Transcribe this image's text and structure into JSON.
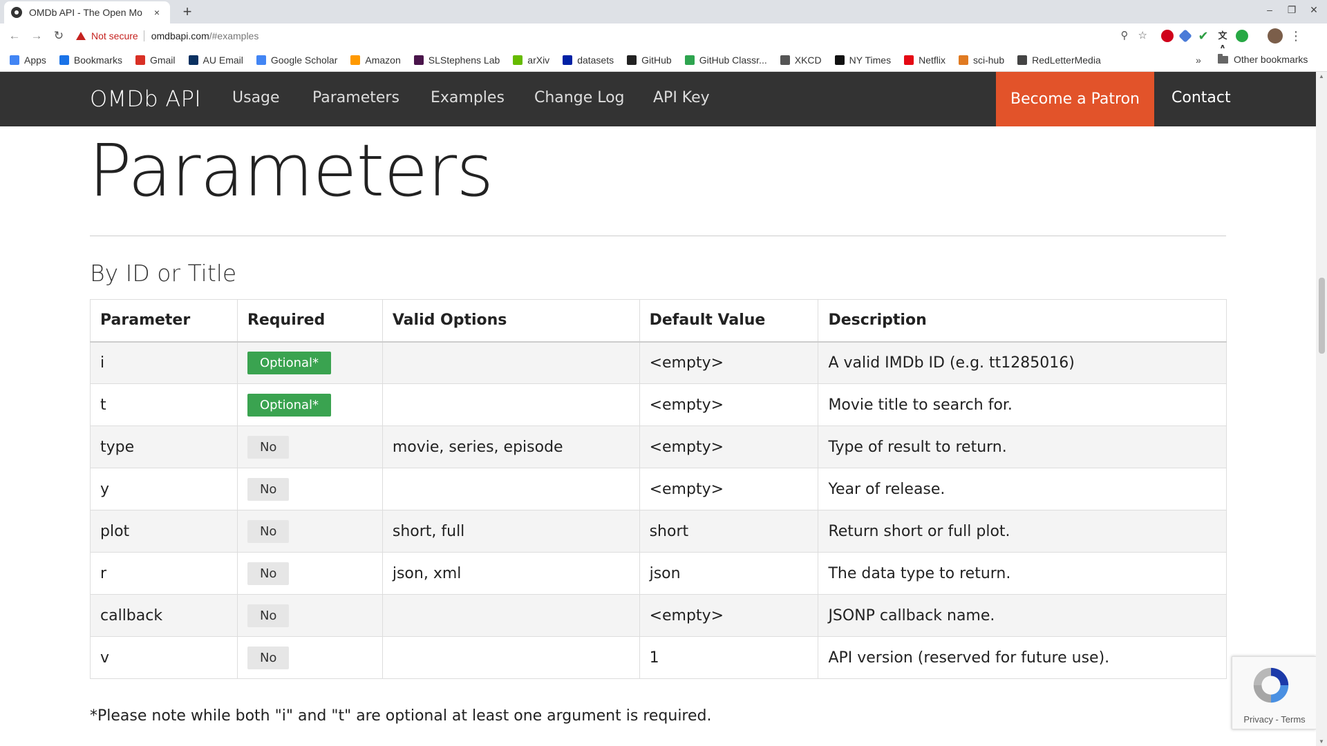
{
  "browser": {
    "tab_title": "OMDb API - The Open Mo",
    "tab_close": "×",
    "new_tab": "+",
    "not_secure": "Not secure",
    "url_host": "omdbapi.com",
    "url_path": "/#examples",
    "bookmarks": [
      {
        "label": "Apps",
        "icon": "apps-grid-icon",
        "color": "#4285f4"
      },
      {
        "label": "Bookmarks",
        "icon": "star-icon",
        "color": "#1a73e8"
      },
      {
        "label": "Gmail",
        "icon": "gmail-icon",
        "color": "#d93025"
      },
      {
        "label": "AU Email",
        "icon": "au-icon",
        "color": "#0a3161"
      },
      {
        "label": "Google Scholar",
        "icon": "scholar-icon",
        "color": "#4285f4"
      },
      {
        "label": "Amazon",
        "icon": "amazon-icon",
        "color": "#ff9900"
      },
      {
        "label": "SLStephens Lab",
        "icon": "slack-icon",
        "color": "#4a154b"
      },
      {
        "label": "arXiv",
        "icon": "arxiv-icon",
        "color": "#66bb00"
      },
      {
        "label": "datasets",
        "icon": "uf-icon",
        "color": "#0021a5"
      },
      {
        "label": "GitHub",
        "icon": "github-icon",
        "color": "#222222"
      },
      {
        "label": "GitHub Classr...",
        "icon": "github-classroom-icon",
        "color": "#2ea44f"
      },
      {
        "label": "XKCD",
        "icon": "xkcd-icon",
        "color": "#555555"
      },
      {
        "label": "NY Times",
        "icon": "nytimes-icon",
        "color": "#111111"
      },
      {
        "label": "Netflix",
        "icon": "netflix-icon",
        "color": "#e50914"
      },
      {
        "label": "sci-hub",
        "icon": "scihub-icon",
        "color": "#e07a22"
      },
      {
        "label": "RedLetterMedia",
        "icon": "rlm-icon",
        "color": "#444444"
      }
    ],
    "bookmarks_more": "»",
    "other_bookmarks": "Other bookmarks"
  },
  "site_nav": {
    "brand": "OMDb API",
    "links": [
      "Usage",
      "Parameters",
      "Examples",
      "Change Log",
      "API Key"
    ],
    "patron": "Become a Patron",
    "contact": "Contact",
    "patron_color": "#e2532a"
  },
  "page": {
    "title": "Parameters",
    "section": "By ID or Title",
    "columns": [
      "Parameter",
      "Required",
      "Valid Options",
      "Default Value",
      "Description"
    ],
    "rows": [
      {
        "param": "i",
        "required": "Optional*",
        "required_kind": "optional",
        "options": "",
        "default": "<empty>",
        "description": "A valid IMDb ID (e.g. tt1285016)"
      },
      {
        "param": "t",
        "required": "Optional*",
        "required_kind": "optional",
        "options": "",
        "default": "<empty>",
        "description": "Movie title to search for."
      },
      {
        "param": "type",
        "required": "No",
        "required_kind": "no",
        "options": "movie, series, episode",
        "default": "<empty>",
        "description": "Type of result to return."
      },
      {
        "param": "y",
        "required": "No",
        "required_kind": "no",
        "options": "",
        "default": "<empty>",
        "description": "Year of release."
      },
      {
        "param": "plot",
        "required": "No",
        "required_kind": "no",
        "options": "short, full",
        "default": "short",
        "description": "Return short or full plot."
      },
      {
        "param": "r",
        "required": "No",
        "required_kind": "no",
        "options": "json, xml",
        "default": "json",
        "description": "The data type to return."
      },
      {
        "param": "callback",
        "required": "No",
        "required_kind": "no",
        "options": "",
        "default": "<empty>",
        "description": "JSONP callback name."
      },
      {
        "param": "v",
        "required": "No",
        "required_kind": "no",
        "options": "",
        "default": "1",
        "description": "API version (reserved for future use)."
      }
    ],
    "note": "*Please note while both \"i\" and \"t\" are optional at least one argument is required."
  },
  "recaptcha": {
    "terms": "Privacy - Terms"
  }
}
